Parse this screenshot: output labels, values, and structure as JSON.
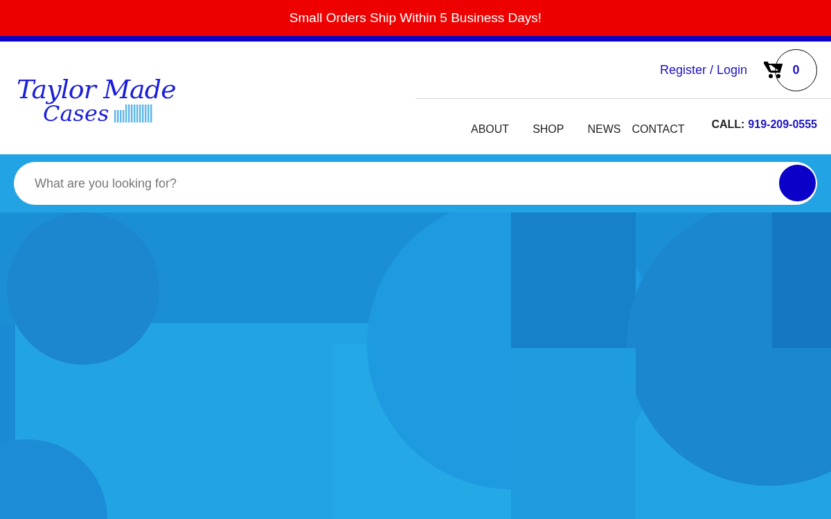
{
  "announcement": "Small Orders Ship Within 5 Business Days!",
  "logo": {
    "line_1": "Taylor Made",
    "line_2": "Cases"
  },
  "account_link": "Register / Login",
  "cart": {
    "count": "0"
  },
  "nav": [
    {
      "label": "ABOUT"
    },
    {
      "label": "SHOP"
    },
    {
      "label": "NEWS"
    },
    {
      "label": "CONTACT"
    }
  ],
  "call": {
    "label": "CALL:",
    "phone": "919-209-0555"
  },
  "search": {
    "placeholder": "What are you looking for?"
  }
}
